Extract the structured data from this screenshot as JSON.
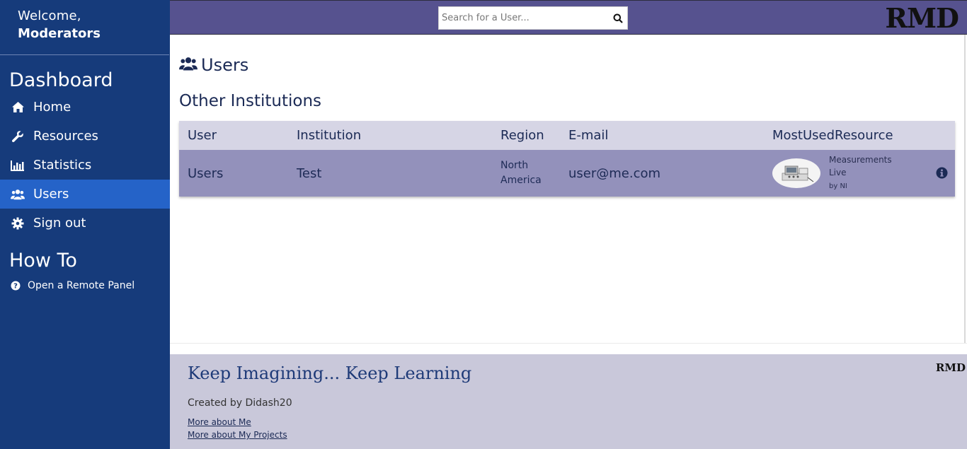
{
  "sidebar": {
    "welcome_line": "Welcome,",
    "welcome_user": "Moderators",
    "dashboard_heading": "Dashboard",
    "items": [
      {
        "label": "Home",
        "icon": "home-icon"
      },
      {
        "label": "Resources",
        "icon": "wrench-icon"
      },
      {
        "label": "Statistics",
        "icon": "bar-chart-icon"
      },
      {
        "label": "Users",
        "icon": "users-icon",
        "active": true
      },
      {
        "label": "Sign out",
        "icon": "gear-icon"
      }
    ],
    "howto_heading": "How To",
    "howto_items": [
      {
        "label": "Open a Remote Panel",
        "icon": "question-circle-icon"
      }
    ]
  },
  "topbar": {
    "search_placeholder": "Search for a User...",
    "logo": "RMD"
  },
  "main": {
    "title": "Users",
    "section_title": "Other Institutions",
    "table": {
      "headers": [
        "User",
        "Institution",
        "Region",
        "E-mail",
        "MostUsedResource"
      ],
      "rows": [
        {
          "user": "Users",
          "institution": "Test",
          "region_line1": "North",
          "region_line2": "America",
          "email": "user@me.com",
          "resource_name_line1": "Measurements",
          "resource_name_line2": "Live",
          "resource_by": "by NI"
        }
      ]
    }
  },
  "footer": {
    "tagline": "Keep Imagining... Keep Learning",
    "created_by": "Created by Didash20",
    "link_me": "More about Me",
    "link_projects": "More about My Projects",
    "logo": "RMD"
  },
  "colors": {
    "sidebar_bg": "#163b7b",
    "sidebar_active": "#2563c8",
    "topbar_bg": "#56528f",
    "table_header_bg": "#d6d5e5",
    "table_row_bg": "#9391bb",
    "footer_bg": "#c9c8da"
  }
}
